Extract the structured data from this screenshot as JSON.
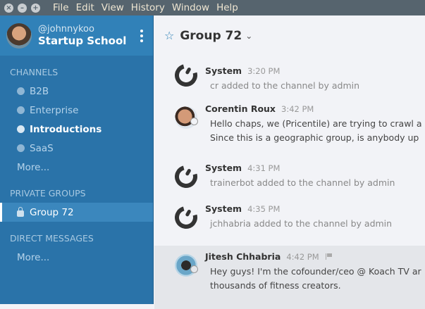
{
  "menubar": {
    "items": [
      "File",
      "Edit",
      "View",
      "History",
      "Window",
      "Help"
    ]
  },
  "team": {
    "username": "@johnnykoo",
    "name": "Startup School"
  },
  "sidebar": {
    "channels_header": "CHANNELS",
    "channels": [
      "B2B",
      "Enterprise",
      "Introductions",
      "SaaS"
    ],
    "channels_more": "More...",
    "private_header": "PRIVATE GROUPS",
    "private": [
      "Group 72"
    ],
    "dm_header": "DIRECT MESSAGES",
    "dm_more": "More..."
  },
  "channel": {
    "title": "Group 72"
  },
  "posts": [
    {
      "name": "System",
      "time": "3:20 PM",
      "lines": [
        "cr added to the channel by admin"
      ]
    },
    {
      "name": "Corentin Roux",
      "time": "3:42 PM",
      "lines": [
        "Hello chaps, we (Pricentile) are trying to crawl a",
        "Since this is a geographic group, is anybody up"
      ]
    },
    {
      "name": "System",
      "time": "4:31 PM",
      "lines": [
        "trainerbot added to the channel by admin"
      ]
    },
    {
      "name": "System",
      "time": "4:35 PM",
      "lines": [
        "jchhabria added to the channel by admin"
      ]
    },
    {
      "name": "Jitesh Chhabria",
      "time": "4:42 PM",
      "lines": [
        "Hey guys! I'm the cofounder/ceo @ Koach TV ar",
        "thousands of fitness creators."
      ]
    }
  ]
}
